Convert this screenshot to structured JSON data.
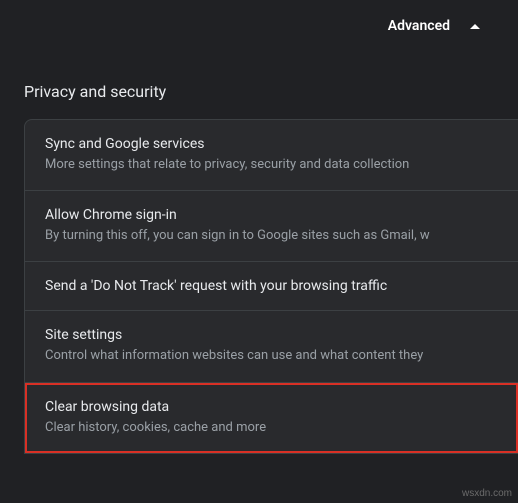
{
  "header": {
    "advanced_label": "Advanced"
  },
  "section": {
    "title": "Privacy and security"
  },
  "items": [
    {
      "title": "Sync and Google services",
      "subtitle": "More settings that relate to privacy, security and data collection"
    },
    {
      "title": "Allow Chrome sign-in",
      "subtitle": "By turning this off, you can sign in to Google sites such as Gmail, w"
    },
    {
      "title": "Send a 'Do Not Track' request with your browsing traffic",
      "subtitle": ""
    },
    {
      "title": "Site settings",
      "subtitle": "Control what information websites can use and what content they"
    },
    {
      "title": "Clear browsing data",
      "subtitle": "Clear history, cookies, cache and more"
    }
  ],
  "watermark": "wsxdn.com"
}
